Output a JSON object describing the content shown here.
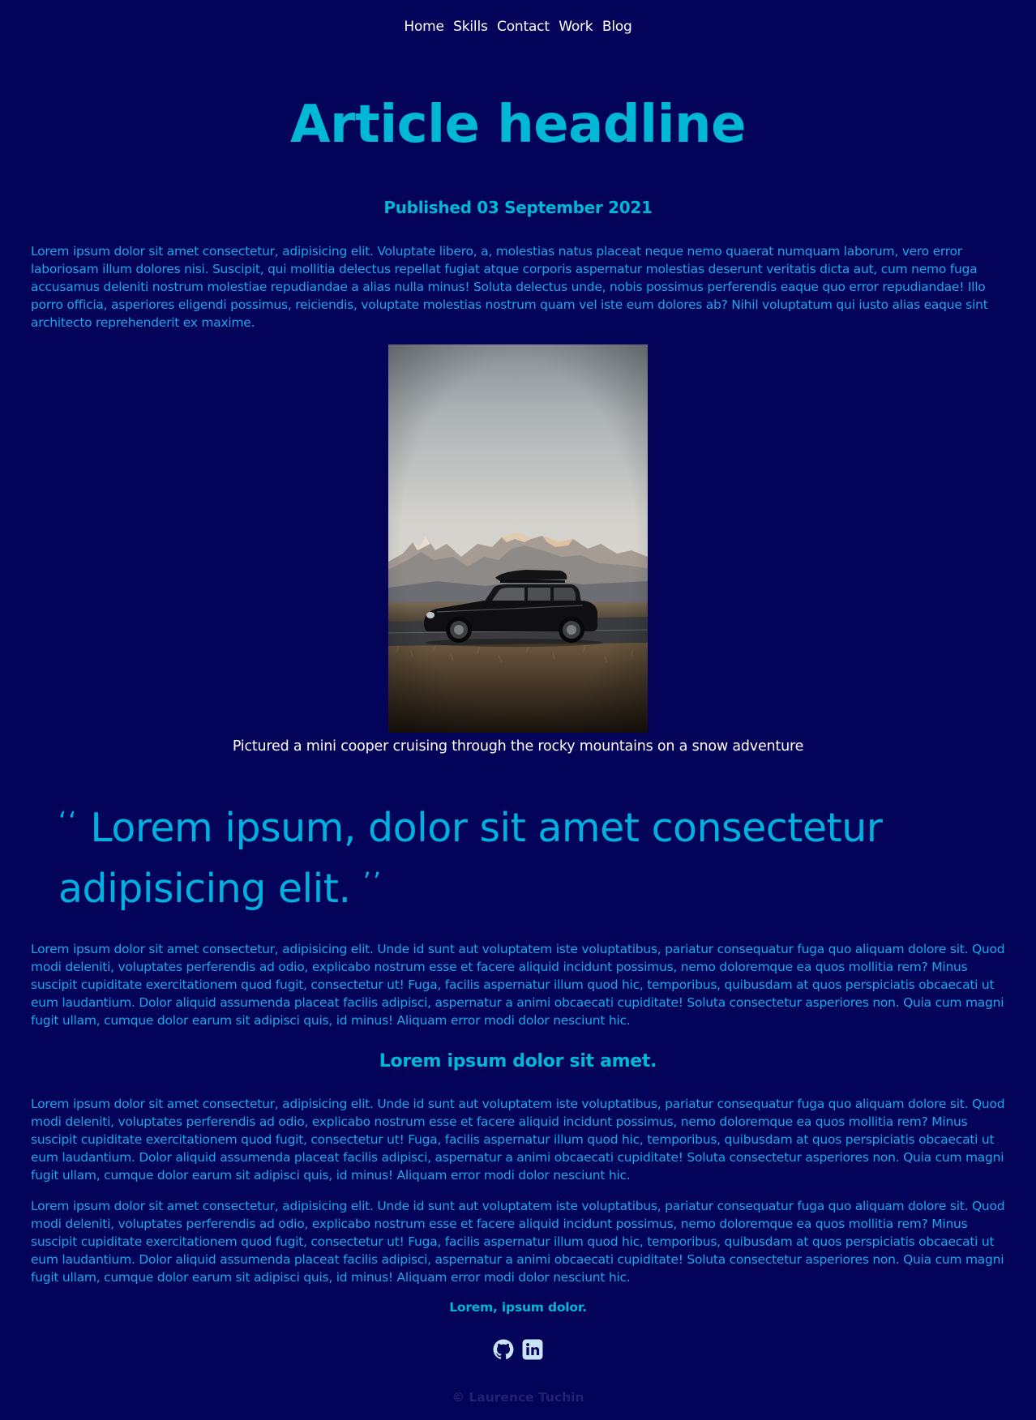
{
  "nav": {
    "items": [
      "Home",
      "Skills",
      "Contact",
      "Work",
      "Blog"
    ]
  },
  "article": {
    "headline": "Article headline",
    "published": "Published 03 September 2021",
    "intro": "Lorem ipsum dolor sit amet consectetur, adipisicing elit. Voluptate libero, a, molestias natus placeat neque nemo quaerat numquam laborum, vero error laboriosam illum dolores nisi. Suscipit, qui mollitia delectus repellat fugiat atque corporis aspernatur molestias deserunt veritatis dicta aut, cum nemo fuga accusamus deleniti nostrum molestiae repudiandae a alias nulla minus! Soluta delectus unde, nobis possimus perferendis eaque quo error repudiandae! Illo porro officia, asperiores eligendi possimus, reiciendis, voluptate molestias nostrum quam vel iste eum dolores ab? Nihil voluptatum qui iusto alias eaque sint architecto reprehenderit ex maxime.",
    "image_alt": "mini cooper with roof box parked in front of snowy mountains",
    "caption": "Pictured a mini cooper cruising through the rocky mountains on a snow adventure",
    "quote_open": "‘‘",
    "quote_text": "Lorem ipsum, dolor sit amet consectetur adipisicing elit.",
    "quote_close": "’’",
    "paragraph_2": "Lorem ipsum dolor sit amet consectetur, adipisicing elit. Unde id sunt aut voluptatem iste voluptatibus, pariatur consequatur fuga quo aliquam dolore sit. Quod modi deleniti, voluptates perferendis ad odio, explicabo nostrum esse et facere aliquid incidunt possimus, nemo doloremque ea quos mollitia rem? Minus suscipit cupiditate exercitationem quod fugit, consectetur ut! Fuga, facilis aspernatur illum quod hic, temporibus, quibusdam at quos perspiciatis obcaecati ut eum laudantium. Dolor aliquid assumenda placeat facilis adipisci, aspernatur a animi obcaecati cupiditate! Soluta consectetur asperiores non. Quia cum magni fugit ullam, cumque dolor earum sit adipisci quis, id minus! Aliquam error modi dolor nesciunt hic.",
    "subheading": "Lorem ipsum dolor sit amet.",
    "paragraph_3": "Lorem ipsum dolor sit amet consectetur, adipisicing elit. Unde id sunt aut voluptatem iste voluptatibus, pariatur consequatur fuga quo aliquam dolore sit. Quod modi deleniti, voluptates perferendis ad odio, explicabo nostrum esse et facere aliquid incidunt possimus, nemo doloremque ea quos mollitia rem? Minus suscipit cupiditate exercitationem quod fugit, consectetur ut! Fuga, facilis aspernatur illum quod hic, temporibus, quibusdam at quos perspiciatis obcaecati ut eum laudantium. Dolor aliquid assumenda placeat facilis adipisci, aspernatur a animi obcaecati cupiditate! Soluta consectetur asperiores non. Quia cum magni fugit ullam, cumque dolor earum sit adipisci quis, id minus! Aliquam error modi dolor nesciunt hic.",
    "paragraph_4": "Lorem ipsum dolor sit amet consectetur, adipisicing elit. Unde id sunt aut voluptatem iste voluptatibus, pariatur consequatur fuga quo aliquam dolore sit. Quod modi deleniti, voluptates perferendis ad odio, explicabo nostrum esse et facere aliquid incidunt possimus, nemo doloremque ea quos mollitia rem? Minus suscipit cupiditate exercitationem quod fugit, consectetur ut! Fuga, facilis aspernatur illum quod hic, temporibus, quibusdam at quos perspiciatis obcaecati ut eum laudantium. Dolor aliquid assumenda placeat facilis adipisci, aspernatur a animi obcaecati cupiditate! Soluta consectetur asperiores non. Quia cum magni fugit ullam, cumque dolor earum sit adipisci quis, id minus! Aliquam error modi dolor nesciunt hic.",
    "closing": "Lorem, ipsum dolor."
  },
  "socials": {
    "icons": [
      "github-icon",
      "linkedin-icon"
    ]
  },
  "footer": {
    "copyright": "© Laurence Tuchin"
  },
  "colors": {
    "background": "#03035a",
    "accent": "#00b7d6",
    "body_text": "#1aa7e8",
    "nav_text": "#ffffff",
    "footer_text": "#22226e"
  }
}
